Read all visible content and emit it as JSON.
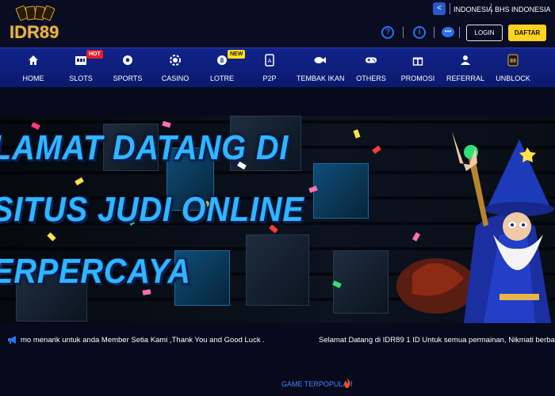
{
  "brand": {
    "logo_text": "IDR89"
  },
  "header": {
    "languages": [
      "INDONESIA",
      "BHS INDONESIA"
    ],
    "login_label": "LOGIN",
    "register_label": "DAFTAR"
  },
  "nav": [
    {
      "label": "HOME",
      "icon": "home-icon"
    },
    {
      "label": "SLOTS",
      "icon": "slot-machine-icon",
      "badge": "HOT"
    },
    {
      "label": "SPORTS",
      "icon": "soccer-ball-icon"
    },
    {
      "label": "CASINO",
      "icon": "casino-chip-icon"
    },
    {
      "label": "LOTRE",
      "icon": "lottery-ball-icon",
      "badge": "NEW"
    },
    {
      "label": "P2P",
      "icon": "playing-card-icon"
    },
    {
      "label": "TEMBAK IKAN",
      "icon": "fish-icon"
    },
    {
      "label": "OTHERS",
      "icon": "gamepad-icon"
    },
    {
      "label": "PROMOSI",
      "icon": "gift-icon"
    },
    {
      "label": "REFERRAL",
      "icon": "users-icon"
    },
    {
      "label": "UNBLOCK",
      "icon": "idr89-badge-icon"
    }
  ],
  "banner": {
    "lines": [
      "LAMAT DATANG DI",
      "SITUS JUDI ONLINE",
      "ERPERCAYA"
    ]
  },
  "marquee": {
    "text_left": "mo menarik untuk anda Member Setia Kami ,Thank You and Good Luck .",
    "text_right": "Selamat Datang di IDR89 1 ID Untuk semua permainan, Nikmati berbagai pro"
  },
  "sections": {
    "popular_title": "GAME TERPOPULAR"
  },
  "colors": {
    "nav_bg": "#12238a",
    "accent_gold": "#e6b54a",
    "register_yellow": "#ffd21f",
    "headline_blue": "#2fb6ff"
  }
}
